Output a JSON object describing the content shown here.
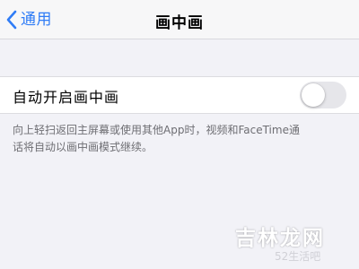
{
  "nav": {
    "back_label": "通用",
    "title": "画中画"
  },
  "settings": {
    "row_label": "自动开启画中画",
    "toggle_on": false,
    "footer_line1": "向上轻扫返回主屏幕或使用其他App时，视频和FaceTime通",
    "footer_line2": "话将自动以画中画模式继续。"
  },
  "watermark": {
    "text": "吉林龙网",
    "text2": "52生活吧"
  },
  "colors": {
    "accent": "#2f7cf6",
    "background": "#f2f2f7",
    "toggle_off": "#e6e6ea"
  }
}
